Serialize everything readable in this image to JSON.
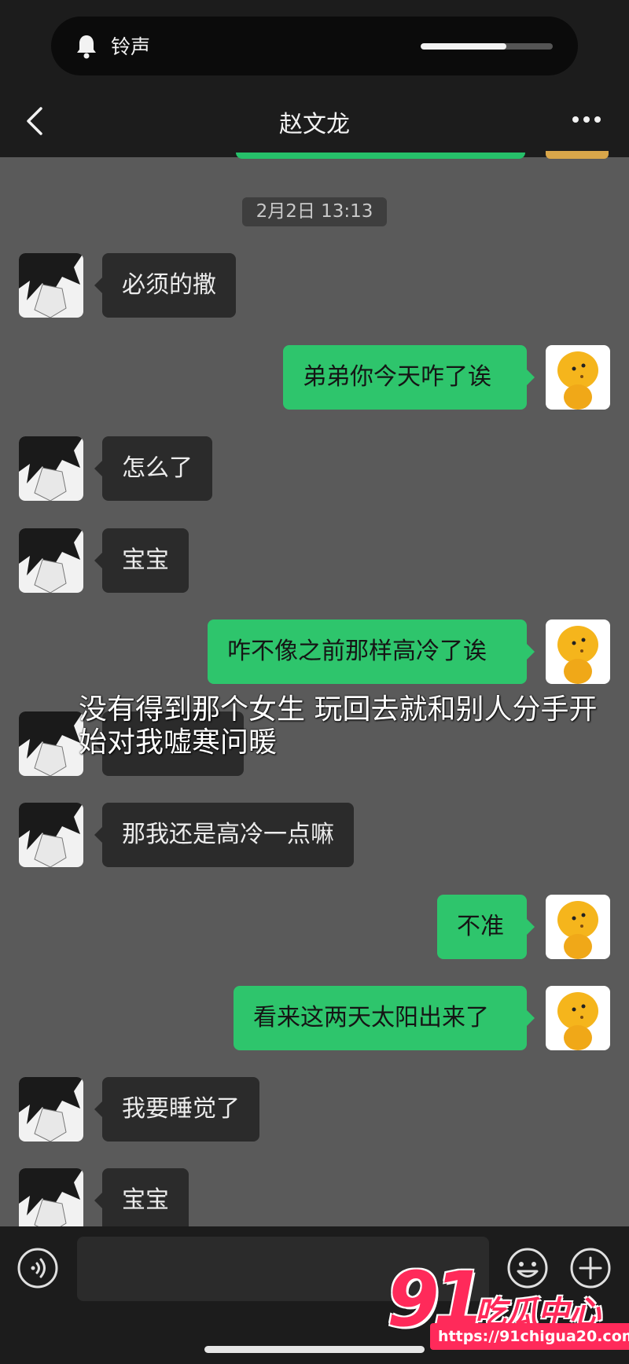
{
  "status": {
    "ringer_label": "铃声",
    "volume_level": 0.65
  },
  "header": {
    "title": "赵文龙"
  },
  "timestamp": "2月2日 13:13",
  "messages": [
    {
      "side": "in",
      "text": "必须的撒"
    },
    {
      "side": "out",
      "text": "弟弟你今天咋了诶"
    },
    {
      "side": "in",
      "text": "怎么了"
    },
    {
      "side": "in",
      "text": "宝宝"
    },
    {
      "side": "out",
      "text": "咋不像之前那样高冷了诶"
    },
    {
      "side": "in",
      "text": ""
    },
    {
      "side": "in",
      "text": "那我还是高冷一点嘛"
    },
    {
      "side": "out",
      "text": "不准"
    },
    {
      "side": "out",
      "text": "看来这两天太阳出来了"
    },
    {
      "side": "in",
      "text": "我要睡觉了"
    },
    {
      "side": "in",
      "text": "宝宝"
    }
  ],
  "overlay_caption": "没有得到那个女生 玩回去就和别人分手开始对我嘘寒问暖",
  "composer": {
    "placeholder": ""
  },
  "watermark": {
    "brand_number": "91",
    "brand_name": "吃瓜中心",
    "url": "https://91chigua20.com"
  },
  "colors": {
    "outgoing_bubble": "#2ec56c",
    "incoming_bubble": "#2b2b2b",
    "watermark": "#ff2a5a"
  }
}
